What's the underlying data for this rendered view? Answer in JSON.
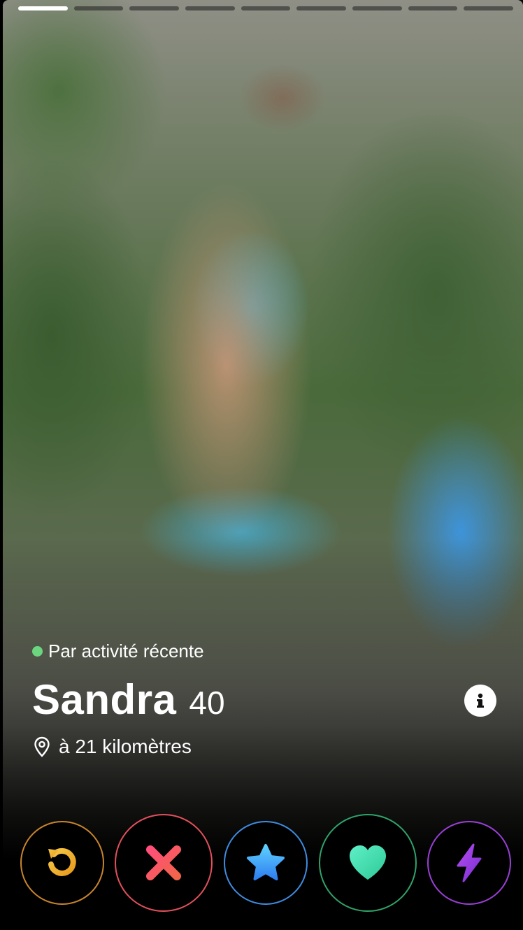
{
  "profile": {
    "name": "Sandra",
    "age": "40",
    "activity_label": "Par activité récente",
    "distance": "à 21 kilomètres"
  },
  "photos": {
    "total": 9,
    "current": 1
  },
  "icons": {
    "activity_dot": "green-dot-icon",
    "location": "location-pin-icon",
    "info": "info-icon",
    "rewind": "rewind-icon",
    "nope": "close-icon",
    "superlike": "star-icon",
    "like": "heart-icon",
    "boost": "lightning-icon"
  },
  "colors": {
    "active_dot": "#6bd67f",
    "rewind": "#f2b632",
    "nope": "#f0556a",
    "superlike": "#3ea8f5",
    "like": "#4fe0a8",
    "boost": "#9b3fd6"
  }
}
